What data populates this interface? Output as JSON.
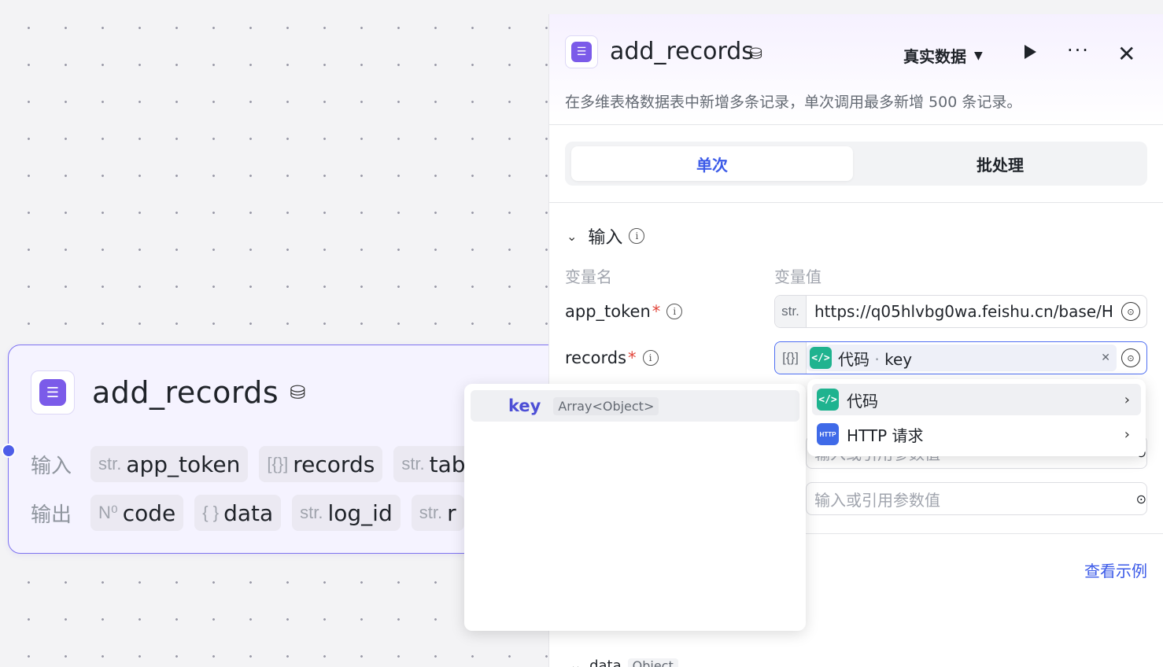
{
  "canvas_node": {
    "title": "add_records",
    "input_label": "输入",
    "output_label": "输出",
    "inputs": [
      {
        "type": "str.",
        "name": "app_token"
      },
      {
        "type": "[{}]",
        "name": "records"
      },
      {
        "type": "str.",
        "name": "tab"
      }
    ],
    "outputs": [
      {
        "type": "N⁰",
        "name": "code"
      },
      {
        "type": "{ }",
        "name": "data"
      },
      {
        "type": "str.",
        "name": "log_id"
      },
      {
        "type": "str.",
        "name": "r"
      }
    ]
  },
  "panel": {
    "title": "add_records",
    "mode": "真实数据",
    "description": "在多维表格数据表中新增多条记录，单次调用最多新增 500 条记录。",
    "tabs": [
      "单次",
      "批处理"
    ],
    "section_title": "输入",
    "col_name": "变量名",
    "col_value": "变量值",
    "fields": [
      {
        "label": "app_token",
        "type": "str.",
        "value": "https://q05hlvbg0wa.feishu.cn/base/H"
      },
      {
        "label": "records",
        "type": "[{}]",
        "ref_source": "代码",
        "ref_sep": " · ",
        "ref_key": "key"
      }
    ],
    "placeholder_partial": "输入或引用参数值",
    "placeholder": "输入或引用参数值",
    "example_link": "查看示例",
    "bottom_peek": {
      "name": "data",
      "type": "Object"
    }
  },
  "popover_vars": {
    "key": "key",
    "type": "Array<Object>"
  },
  "popover_sources": [
    "代码",
    "HTTP 请求"
  ],
  "colors": {
    "accent": "#3b5ae8",
    "node_border": "#7d72f0",
    "code_icon": "#1fb38f",
    "http_icon": "#3f6ae8",
    "required": "#e2463b"
  }
}
